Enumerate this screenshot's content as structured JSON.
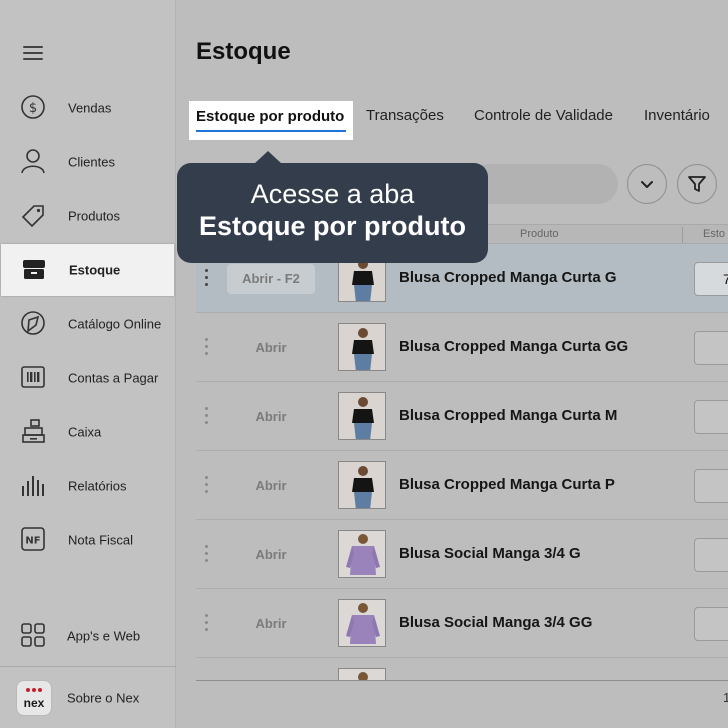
{
  "sidebar": {
    "items": [
      {
        "label": "Vendas",
        "icon": "dollar-circle-icon"
      },
      {
        "label": "Clientes",
        "icon": "user-icon"
      },
      {
        "label": "Produtos",
        "icon": "tag-icon"
      },
      {
        "label": "Estoque",
        "icon": "box-icon",
        "active": true
      },
      {
        "label": "Catálogo Online",
        "icon": "catalog-icon"
      },
      {
        "label": "Contas a Pagar",
        "icon": "barcode-icon"
      },
      {
        "label": "Caixa",
        "icon": "register-icon"
      },
      {
        "label": "Relatórios",
        "icon": "bars-icon"
      },
      {
        "label": "Nota Fiscal",
        "icon": "nf-icon",
        "icon_text": "NF"
      }
    ],
    "bottom_items": [
      {
        "label": "App's e Web",
        "icon": "grid-icon"
      },
      {
        "label": "Sobre o Nex",
        "icon": "nex-logo",
        "logo_text": "nex"
      }
    ]
  },
  "main": {
    "title": "Estoque",
    "tabs": [
      {
        "label": "Estoque por produto",
        "active": true
      },
      {
        "label": "Transações"
      },
      {
        "label": "Controle de Validade"
      },
      {
        "label": "Inventário"
      }
    ],
    "table": {
      "columns": [
        "Produto",
        "Esto"
      ],
      "rows": [
        {
          "action": "Abrir - F2",
          "name": "Blusa Cropped Manga Curta G",
          "qty": "7",
          "highlighted": true,
          "thumb": "black-top"
        },
        {
          "action": "Abrir",
          "name": "Blusa Cropped Manga Curta GG",
          "qty": "",
          "thumb": "black-top"
        },
        {
          "action": "Abrir",
          "name": "Blusa Cropped Manga Curta M",
          "qty": "",
          "thumb": "black-top"
        },
        {
          "action": "Abrir",
          "name": "Blusa Cropped Manga Curta P",
          "qty": "",
          "thumb": "black-top"
        },
        {
          "action": "Abrir",
          "name": "Blusa Social Manga 3/4 G",
          "qty": "",
          "thumb": "lilac-shirt"
        },
        {
          "action": "Abrir",
          "name": "Blusa Social Manga 3/4 GG",
          "qty": "",
          "thumb": "lilac-shirt"
        }
      ],
      "footer_text": "1"
    }
  },
  "tooltip": {
    "line1": "Acesse a aba",
    "line2": "Estoque por produto"
  },
  "colors": {
    "tab_underline": "#1f73d9",
    "tooltip_bg": "#333d4b",
    "nex_brand": "#c81f2d"
  }
}
